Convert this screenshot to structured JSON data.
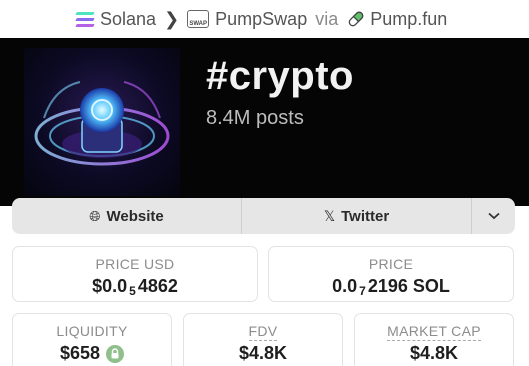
{
  "breadcrumb": {
    "chain": "Solana",
    "dex": "PumpSwap",
    "via": "via",
    "launchpad": "Pump.fun",
    "dex_icon_text": "SWAP"
  },
  "hero": {
    "title": "#crypto",
    "subtitle": "8.4M posts"
  },
  "links": {
    "website": "Website",
    "twitter": "Twitter",
    "more_icon": "chevron-down-icon"
  },
  "stats": {
    "price_usd": {
      "label": "PRICE USD",
      "prefix": "$0.0",
      "zeros": "5",
      "digits": "4862"
    },
    "price_sol": {
      "label": "PRICE",
      "prefix": "0.0",
      "zeros": "7",
      "digits": "2196 SOL"
    },
    "liquidity": {
      "label": "LIQUIDITY",
      "value": "$658"
    },
    "fdv": {
      "label": "FDV",
      "value": "$4.8K"
    },
    "market_cap": {
      "label": "MARKET CAP",
      "value": "$4.8K"
    }
  },
  "colors": {
    "solana_top": "#4fe3c1",
    "solana_mid": "#8b6cf0",
    "solana_bottom": "#b463e6",
    "hero_bg": "#050505",
    "lock_green": "#8fbf8a"
  }
}
